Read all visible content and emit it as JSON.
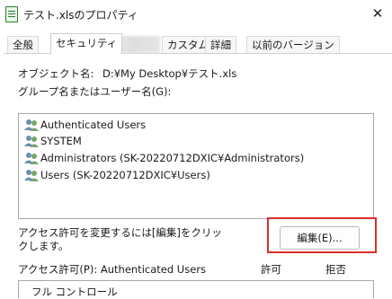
{
  "window": {
    "title": "テスト.xlsのプロパティ",
    "close_glyph": "✕"
  },
  "tabs": [
    {
      "label": "全般"
    },
    {
      "label": "セキュリティ"
    },
    {
      "label": "カスタム"
    },
    {
      "label": "詳細"
    },
    {
      "label": "以前のバージョン"
    }
  ],
  "security": {
    "object_name_label": "オブジェクト名:",
    "object_name_value": "D:¥My Desktop¥テスト.xls",
    "group_label": "グループ名またはユーザー名(G):",
    "users": [
      {
        "name": "Authenticated Users"
      },
      {
        "name": "SYSTEM"
      },
      {
        "name": "Administrators (SK-20220712DXIC¥Administrators)"
      },
      {
        "name": "Users (SK-20220712DXIC¥Users)"
      }
    ],
    "change_hint_line1": "アクセス許可を変更するには[編集]をクリッ",
    "change_hint_line2": "クします。",
    "edit_button_label": "編集(E)...",
    "permissions_label": "アクセス許可(P): Authenticated Users",
    "allow_header": "許可",
    "deny_header": "拒否",
    "permissions": [
      {
        "name": "フル コントロール"
      }
    ]
  },
  "colors": {
    "highlight": "#d93025",
    "icon_green": "#2e7d32"
  },
  "icons": {
    "app": "excel-file-icon",
    "user_group": "users-group-icon"
  }
}
